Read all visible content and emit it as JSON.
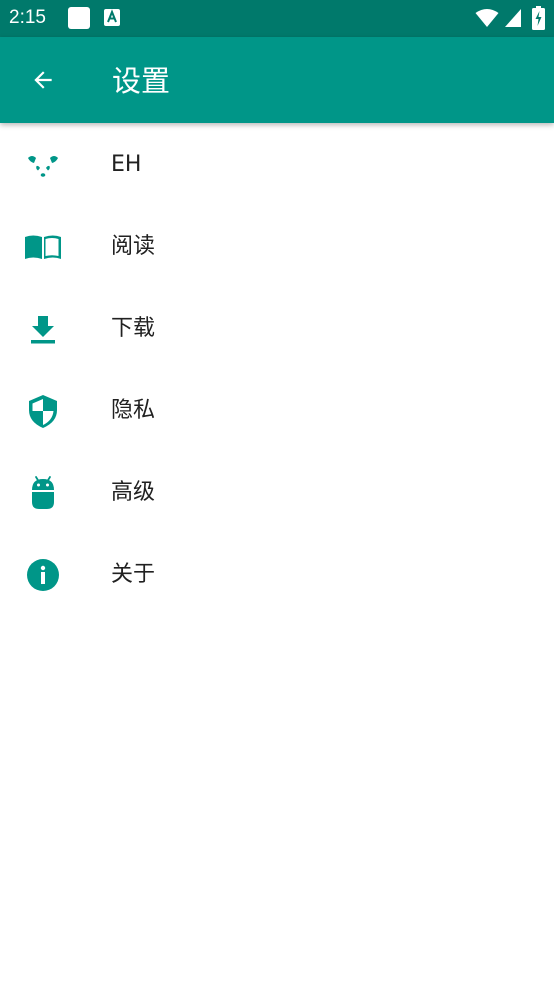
{
  "status_bar": {
    "time": "2:15"
  },
  "app_bar": {
    "title": "设置"
  },
  "settings": {
    "items": [
      {
        "label": "EH",
        "icon": "panda-icon"
      },
      {
        "label": "阅读",
        "icon": "book-icon"
      },
      {
        "label": "下载",
        "icon": "download-icon"
      },
      {
        "label": "隐私",
        "icon": "shield-icon"
      },
      {
        "label": "高级",
        "icon": "android-icon"
      },
      {
        "label": "关于",
        "icon": "info-icon"
      }
    ]
  },
  "colors": {
    "status_bar": "#00796b",
    "app_bar": "#009688",
    "icon_accent": "#009688",
    "text": "#212121"
  }
}
